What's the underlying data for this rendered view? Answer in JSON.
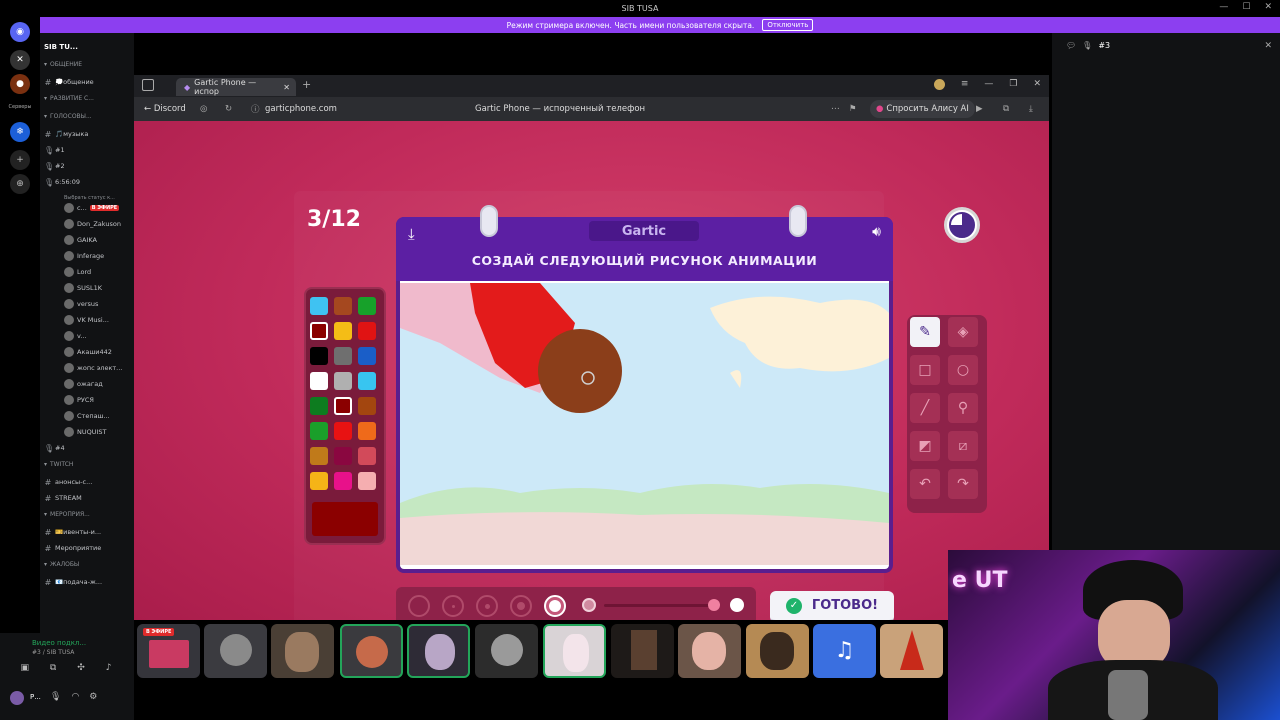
{
  "window": {
    "title": "SIB TUSA"
  },
  "banner": {
    "text": "Режим стримера включен. Часть имени пользователя скрыта.",
    "button": "Отключить"
  },
  "rail": {
    "label": "Серверы"
  },
  "server": {
    "name": "SIB TU..."
  },
  "channels": [
    {
      "type": "cat",
      "label": "ОБЩЕНИЕ"
    },
    {
      "type": "text",
      "label": "💭общение"
    },
    {
      "type": "cat",
      "label": "РАЗВИТИЕ С..."
    },
    {
      "type": "cat",
      "label": "ГОЛОСОВЫ..."
    },
    {
      "type": "text",
      "label": "🎵музыка"
    },
    {
      "type": "voice",
      "label": "#1"
    },
    {
      "type": "voice",
      "label": "#2"
    },
    {
      "type": "voice",
      "label": "6:56:09"
    },
    {
      "type": "status",
      "label": "Выбрать статус к..."
    },
    {
      "type": "user",
      "label": "с..."
    },
    {
      "type": "user",
      "label": "Don_Zakuson"
    },
    {
      "type": "user",
      "label": "GAIKA"
    },
    {
      "type": "user",
      "label": "Inferage"
    },
    {
      "type": "user",
      "label": "Lord"
    },
    {
      "type": "user",
      "label": "SUSL1K"
    },
    {
      "type": "user",
      "label": "versus"
    },
    {
      "type": "user",
      "label": "VK Musi..."
    },
    {
      "type": "user",
      "label": "v..."
    },
    {
      "type": "user",
      "label": "Акаши442"
    },
    {
      "type": "user",
      "label": "жопс элект..."
    },
    {
      "type": "user",
      "label": "ожагад"
    },
    {
      "type": "user",
      "label": "РУСЯ"
    },
    {
      "type": "user",
      "label": "Степаш..."
    },
    {
      "type": "user",
      "label": "ΝUQUIST"
    },
    {
      "type": "voice",
      "label": "#4"
    },
    {
      "type": "cat",
      "label": "TWITCH"
    },
    {
      "type": "text",
      "label": "анонсы-с..."
    },
    {
      "type": "text",
      "label": "STREAM"
    },
    {
      "type": "cat",
      "label": "МЕРОПРИЯ..."
    },
    {
      "type": "text",
      "label": "🎫ивенты-и..."
    },
    {
      "type": "text",
      "label": "Мероприятие"
    },
    {
      "type": "cat",
      "label": "ЖАЛОБЫ"
    },
    {
      "type": "text",
      "label": "📧подача-ж..."
    }
  ],
  "live_badge": "В ЭФИРЕ",
  "voice_panel": {
    "status": "Видео подкл...",
    "channel": "#3 / SIB TUSA",
    "user": "Р..."
  },
  "browser": {
    "tab_title": "Gartic Phone — испор",
    "back_label": "Discord",
    "url": "garticphone.com",
    "page_title": "Gartic Phone — испорченный телефон",
    "alice": "Спросить Алису AI"
  },
  "game": {
    "counter": "3/12",
    "logo": "Gartic",
    "instruction": "СОЗДАЙ СЛЕДУЮЩИЙ РИСУНОК АНИМАЦИИ",
    "done": "ГОТОВО!",
    "selected_color": "#8b0000",
    "colors": [
      "#3fc2f2",
      "#a5481f",
      "#17a12a",
      "#8b0000",
      "#f4bd16",
      "#e01313",
      "#000000",
      "#6f6f6f",
      "#1a5ec8",
      "#ffffff",
      "#b0b0b0",
      "#38c5f0",
      "#0d7c1f",
      "#8b0000",
      "#a3460f",
      "#1a9f2a",
      "#e81212",
      "#ef6a1a",
      "#c07a1a",
      "#8a0740",
      "#d24a5a",
      "#f5b417",
      "#e8118a",
      "#f5aeb0"
    ]
  },
  "right_panel": {
    "channel": "#3"
  },
  "webcam": {
    "neon": "е UT"
  }
}
